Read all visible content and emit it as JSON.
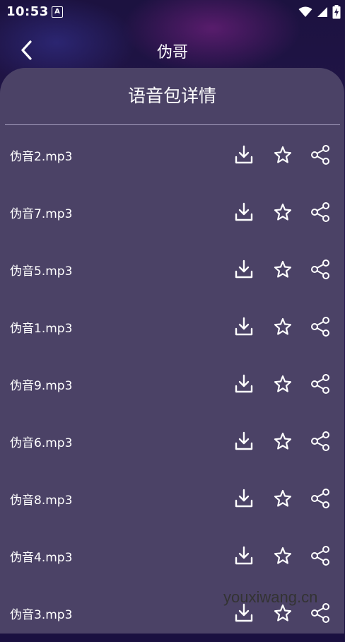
{
  "status_bar": {
    "time": "10:53",
    "notification_icon": "A",
    "icons": [
      "wifi-icon",
      "signal-icon",
      "battery-icon"
    ]
  },
  "header": {
    "title": "伪哥",
    "back_icon": "chevron-left-icon"
  },
  "panel": {
    "title": "语音包详情"
  },
  "items": [
    {
      "name": "伪音2.mp3"
    },
    {
      "name": "伪音7.mp3"
    },
    {
      "name": "伪音5.mp3"
    },
    {
      "name": "伪音1.mp3"
    },
    {
      "name": "伪音9.mp3"
    },
    {
      "name": "伪音6.mp3"
    },
    {
      "name": "伪音8.mp3"
    },
    {
      "name": "伪音4.mp3"
    },
    {
      "name": "伪音3.mp3"
    }
  ],
  "actions": [
    "download-icon",
    "star-icon",
    "share-icon"
  ],
  "watermark": "youxiwang.cn",
  "colors": {
    "panel": "#4b4266",
    "background": "#1c1240",
    "text": "#ffffff"
  }
}
